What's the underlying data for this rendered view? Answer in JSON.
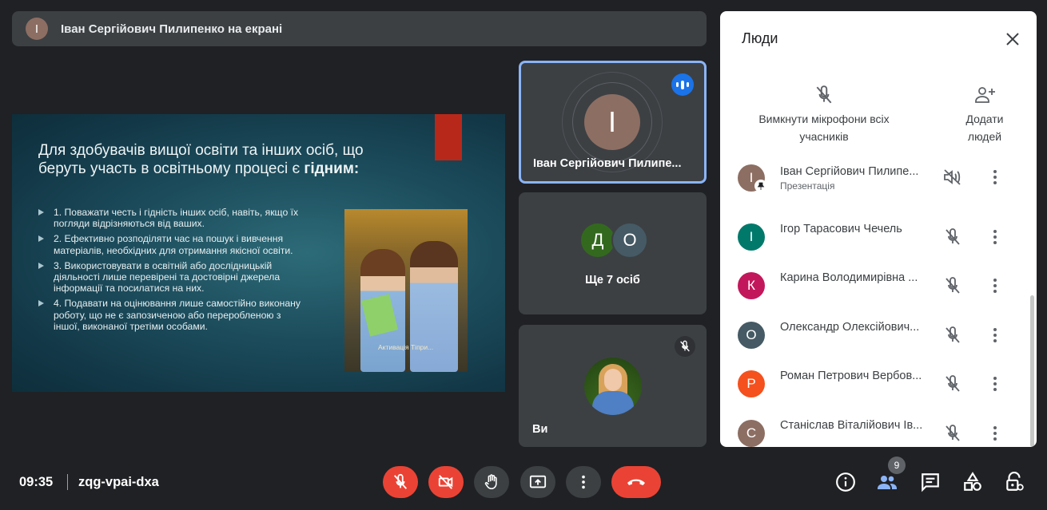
{
  "presenter_bar": {
    "initial": "І",
    "text": "Іван Сергійович Пилипенко на екрані",
    "avatar_color": "#8d6e63"
  },
  "slide": {
    "title_plain": "Для здобувачів вищої освіти та інших осіб, що беруть участь в освітньому процесі є ",
    "title_bold": "гідним:",
    "bullets": [
      "1. Поважати честь і гідність інших осіб, навіть, якщо їх погляди відрізняються від ваших.",
      "2. Ефективно розподіляти час на пошук і вивчення матеріалів, необхідних для отримання якісної освіти.",
      "3. Використовувати в освітній або дослідницькій діяльності лише перевірені та достовірні джерела інформації та посилатися на них.",
      "4. Подавати на оцінювання лише самостійно виконану роботу, що не є запозиченою або переробленою з іншої, виконаної третіми особами."
    ],
    "photo_caption": "Активація Тіпри...",
    "accent_color": "#b8281a"
  },
  "tiles": {
    "presenter": {
      "initial": "І",
      "name": "Іван Сергійович Пилипе...",
      "speaking_icon": "audio-level-icon"
    },
    "others": {
      "initials": [
        "Д",
        "О"
      ],
      "label": "Ще 7 осіб"
    },
    "self": {
      "name": "Ви",
      "muted_icon": "mic-off-icon"
    }
  },
  "people_panel": {
    "title": "Люди",
    "mute_all_label": "Вимкнути мікрофони всіх учасників",
    "add_people_label": "Додати людей",
    "participants": [
      {
        "initial": "І",
        "name": "Іван Сергійович Пилипе...",
        "sub": "Презентація",
        "color": "#8d6e63"
      },
      {
        "initial": "І",
        "name": "Ігор Тарасович Чечель",
        "sub": "",
        "color": "#00796b"
      },
      {
        "initial": "К",
        "name": "Карина Володимирівна ...",
        "sub": "",
        "color": "#c2185b"
      },
      {
        "initial": "О",
        "name": "Олександр Олексійович...",
        "sub": "",
        "color": "#455a64"
      },
      {
        "initial": "Р",
        "name": "Роман Петрович Вербов...",
        "sub": "",
        "color": "#f4511e"
      },
      {
        "initial": "С",
        "name": "Станіслав Віталійович Ів...",
        "sub": "",
        "color": "#8d6e63"
      }
    ]
  },
  "bottom_bar": {
    "time": "09:35",
    "meeting_code": "zqg-vpai-dxa",
    "participants_count": "9",
    "controls": [
      "mic-off-icon",
      "camera-off-icon",
      "raise-hand-icon",
      "present-icon",
      "more-options-icon",
      "end-call-icon"
    ],
    "right_icons": [
      "info-icon",
      "people-icon",
      "chat-icon",
      "activities-icon",
      "host-controls-icon"
    ]
  }
}
